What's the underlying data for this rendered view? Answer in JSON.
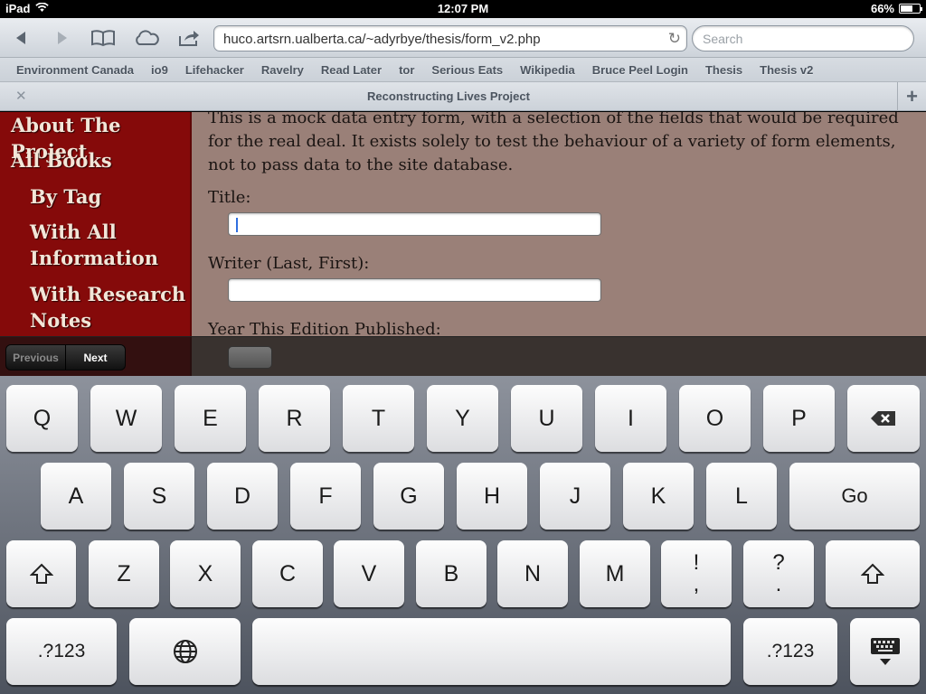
{
  "status": {
    "device": "iPad",
    "time": "12:07 PM",
    "battery": "66%",
    "battery_level": 0.66
  },
  "toolbar": {
    "url": "huco.artsrn.ualberta.ca/~adyrbye/thesis/form_v2.php",
    "search_placeholder": "Search"
  },
  "bookmarks": [
    "Environment Canada",
    "io9",
    "Lifehacker",
    "Ravelry",
    "Read Later",
    "tor",
    "Serious Eats",
    "Wikipedia",
    "Bruce Peel Login",
    "Thesis",
    "Thesis v2"
  ],
  "tab": {
    "title": "Reconstructing Lives Project"
  },
  "sidebar": {
    "items": [
      "About The Project",
      "All Books",
      "By Tag",
      "With All",
      "Information",
      "With Research",
      "Notes"
    ]
  },
  "page": {
    "intro_lines": [
      "This is a mock data entry form, with a selection of the fields that would be required",
      "for the real deal. It exists solely to test the behaviour of a variety of form elements,",
      "not to pass data to the site database."
    ],
    "fields": {
      "title_label": "Title:",
      "writer_label": "Writer (Last, First):",
      "year_label": "Year This Edition Published:"
    }
  },
  "formbar": {
    "previous": "Previous",
    "next": "Next"
  },
  "keyboard": {
    "row1": [
      "Q",
      "W",
      "E",
      "R",
      "T",
      "Y",
      "U",
      "I",
      "O",
      "P"
    ],
    "row2": [
      "A",
      "S",
      "D",
      "F",
      "G",
      "H",
      "J",
      "K",
      "L"
    ],
    "go": "Go",
    "row3": [
      "Z",
      "X",
      "C",
      "V",
      "B",
      "N",
      "M"
    ],
    "exclaim_top": "!",
    "exclaim_bottom": ",",
    "question_top": "?",
    "question_bottom": ".",
    "numbers": ".?123"
  }
}
